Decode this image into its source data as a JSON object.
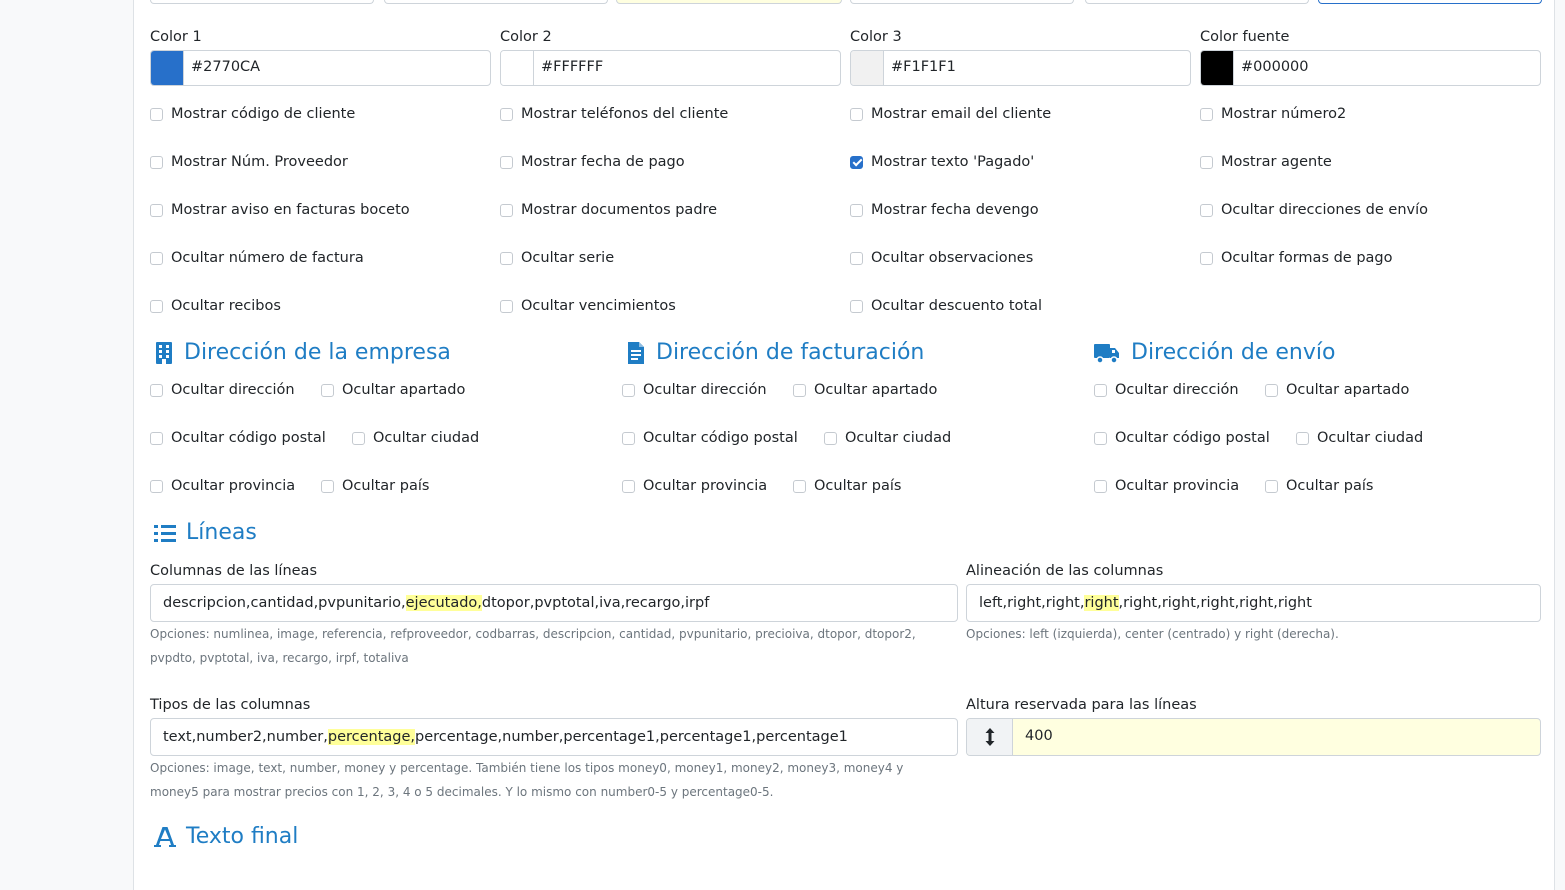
{
  "colors": {
    "color1": {
      "label": "Color 1",
      "value": "#2770CA",
      "swatch": "#2770CA"
    },
    "color2": {
      "label": "Color 2",
      "value": "#FFFFFF",
      "swatch": "#FFFFFF"
    },
    "color3": {
      "label": "Color 3",
      "value": "#F1F1F1",
      "swatch": "#F1F1F1"
    },
    "font": {
      "label": "Color fuente",
      "value": "#000000",
      "swatch": "#000000"
    }
  },
  "options": [
    {
      "label": "Mostrar código de cliente",
      "checked": false
    },
    {
      "label": "Mostrar teléfonos del cliente",
      "checked": false
    },
    {
      "label": "Mostrar email del cliente",
      "checked": false
    },
    {
      "label": "Mostrar número2",
      "checked": false
    },
    {
      "label": "Mostrar Núm. Proveedor",
      "checked": false
    },
    {
      "label": "Mostrar fecha de pago",
      "checked": false
    },
    {
      "label": "Mostrar texto 'Pagado'",
      "checked": true
    },
    {
      "label": "Mostrar agente",
      "checked": false
    },
    {
      "label": "Mostrar aviso en facturas boceto",
      "checked": false
    },
    {
      "label": "Mostrar documentos padre",
      "checked": false
    },
    {
      "label": "Mostrar fecha devengo",
      "checked": false
    },
    {
      "label": "Ocultar direcciones de envío",
      "checked": false
    },
    {
      "label": "Ocultar número de factura",
      "checked": false
    },
    {
      "label": "Ocultar serie",
      "checked": false
    },
    {
      "label": "Ocultar observaciones",
      "checked": false
    },
    {
      "label": "Ocultar formas de pago",
      "checked": false
    },
    {
      "label": "Ocultar recibos",
      "checked": false
    },
    {
      "label": "Ocultar vencimientos",
      "checked": false
    },
    {
      "label": "Ocultar descuento total",
      "checked": false
    }
  ],
  "address_sections": [
    {
      "title": "Dirección de la empresa",
      "icon": "building-icon",
      "items": [
        "Ocultar dirección",
        "Ocultar apartado",
        "Ocultar código postal",
        "Ocultar ciudad",
        "Ocultar provincia",
        "Ocultar país"
      ]
    },
    {
      "title": "Dirección de facturación",
      "icon": "file-invoice-icon",
      "items": [
        "Ocultar dirección",
        "Ocultar apartado",
        "Ocultar código postal",
        "Ocultar ciudad",
        "Ocultar provincia",
        "Ocultar país"
      ]
    },
    {
      "title": "Dirección de envío",
      "icon": "truck-icon",
      "items": [
        "Ocultar dirección",
        "Ocultar apartado",
        "Ocultar código postal",
        "Ocultar ciudad",
        "Ocultar provincia",
        "Ocultar país"
      ]
    }
  ],
  "lines": {
    "title": "Líneas",
    "columns": {
      "label": "Columnas de las líneas",
      "value_before": "descripcion,cantidad,pvpunitario,",
      "value_highlight": "ejecutado,",
      "value_after": "dtopor,pvptotal,iva,recargo,irpf",
      "help_1": "Opciones: numlinea, image, referencia, refproveedor, codbarras, descripcion, cantidad, pvpunitario, precioiva, dtopor, dtopor2,",
      "help_2": "pvpdto, pvptotal, iva, recargo, irpf, totaliva"
    },
    "alignment": {
      "label": "Alineación de las columnas",
      "value_before": "left,right,right,",
      "value_highlight": "right",
      "value_after": ",right,right,right,right,right",
      "help": "Opciones: left (izquierda), center (centrado) y right (derecha)."
    },
    "types": {
      "label": "Tipos de las columnas",
      "value_before": "text,number2,number,",
      "value_highlight": "percentage,",
      "value_after": "percentage,number,percentage1,percentage1,percentage1",
      "help_1": "Opciones: image, text, number, money y percentage. También tiene los tipos money0, money1, money2, money3, money4 y",
      "help_2": "money5 para mostrar precios con 1, 2, 3, 4 o 5 decimales. Y lo mismo con number0-5 y percentage0-5."
    },
    "height": {
      "label": "Altura reservada para las líneas",
      "value": "400",
      "icon": "arrows-vertical-icon"
    }
  },
  "final_text": {
    "title": "Texto final",
    "icon": "font-icon"
  }
}
